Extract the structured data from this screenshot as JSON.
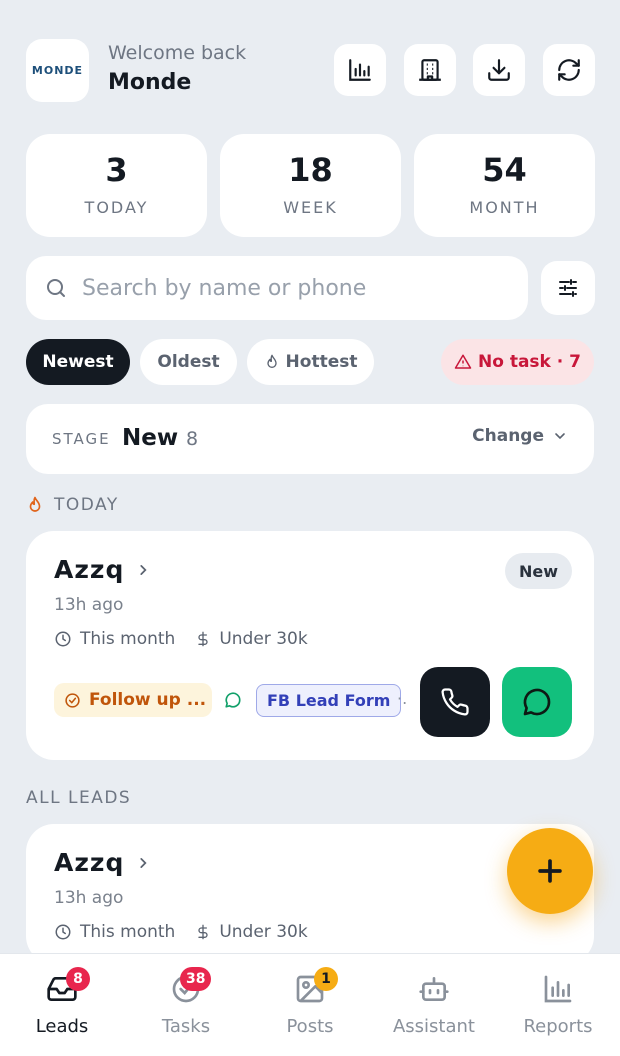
{
  "header": {
    "logo_text": "MONDE",
    "welcome": "Welcome back",
    "user_name": "Monde",
    "actions": [
      "bar-chart-icon",
      "building-icon",
      "download-icon",
      "refresh-icon"
    ]
  },
  "stats": [
    {
      "value": "3",
      "label": "TODAY"
    },
    {
      "value": "18",
      "label": "WEEK"
    },
    {
      "value": "54",
      "label": "MONTH"
    }
  ],
  "search": {
    "placeholder": "Search by name or phone",
    "value": ""
  },
  "sort_chips": {
    "newest": "Newest",
    "oldest": "Oldest",
    "hottest": "Hottest",
    "no_task": "No task · 7",
    "active": "Newest"
  },
  "stage": {
    "label": "STAGE",
    "value": "New",
    "count": "8",
    "change": "Change"
  },
  "sections": {
    "today": "TODAY",
    "all_leads": "ALL LEADS"
  },
  "today_leads": [
    {
      "name": "Azzq",
      "time_ago": "13h ago",
      "timeframe": "This month",
      "budget": "Under 30k",
      "stage_badge": "New",
      "followup": "Follow up ...",
      "source": "FB Lead Form",
      "more": "·."
    }
  ],
  "all_leads": [
    {
      "name": "Azzq",
      "time_ago": "13h ago",
      "timeframe": "This month",
      "budget": "Under 30k"
    }
  ],
  "nav": {
    "items": [
      {
        "label": "Leads",
        "badge": "8"
      },
      {
        "label": "Tasks",
        "badge": "38"
      },
      {
        "label": "Posts",
        "badge": "1"
      },
      {
        "label": "Assistant",
        "badge": ""
      },
      {
        "label": "Reports",
        "badge": ""
      }
    ],
    "active": "Leads"
  },
  "colors": {
    "background": "#e9edf2",
    "dark": "#141a22",
    "whatsapp": "#12c07d",
    "fab": "#f6ac14",
    "danger": "#e8264d"
  }
}
